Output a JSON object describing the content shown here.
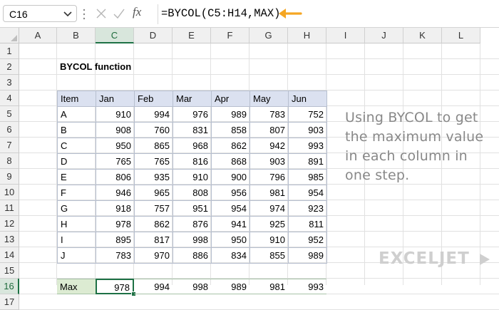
{
  "name_box": {
    "value": "C16"
  },
  "formula_bar": {
    "fx_label": "fx",
    "formula": "=BYCOL(C5:H14,MAX)"
  },
  "columns": [
    "A",
    "B",
    "C",
    "D",
    "E",
    "F",
    "G",
    "H",
    "I",
    "J",
    "K",
    "L"
  ],
  "rows": [
    "1",
    "2",
    "3",
    "4",
    "5",
    "6",
    "7",
    "8",
    "9",
    "10",
    "11",
    "12",
    "13",
    "14",
    "15",
    "16",
    "17"
  ],
  "selected": {
    "column": "C",
    "row": "16"
  },
  "sheet": {
    "title": "BYCOL function",
    "headers": [
      "Item",
      "Jan",
      "Feb",
      "Mar",
      "Apr",
      "May",
      "Jun"
    ],
    "data": [
      [
        "A",
        "910",
        "994",
        "976",
        "989",
        "783",
        "752"
      ],
      [
        "B",
        "908",
        "760",
        "831",
        "858",
        "807",
        "903"
      ],
      [
        "C",
        "950",
        "865",
        "968",
        "862",
        "942",
        "993"
      ],
      [
        "D",
        "765",
        "765",
        "816",
        "868",
        "903",
        "891"
      ],
      [
        "E",
        "806",
        "935",
        "910",
        "900",
        "796",
        "985"
      ],
      [
        "F",
        "946",
        "965",
        "808",
        "956",
        "981",
        "954"
      ],
      [
        "G",
        "918",
        "757",
        "951",
        "954",
        "974",
        "923"
      ],
      [
        "H",
        "978",
        "862",
        "876",
        "941",
        "925",
        "811"
      ],
      [
        "I",
        "895",
        "817",
        "998",
        "950",
        "910",
        "952"
      ],
      [
        "J",
        "783",
        "970",
        "886",
        "834",
        "855",
        "989"
      ]
    ],
    "max_label": "Max",
    "max_values": [
      "978",
      "994",
      "998",
      "989",
      "981",
      "993"
    ]
  },
  "note": "Using BYCOL to get the maximum value in each column in one step.",
  "logo": {
    "text": "EXCELJET"
  },
  "colors": {
    "accent_green": "#1e7145",
    "arrow_orange": "#f5a623",
    "table_header_bg": "#dbe1f0",
    "max_label_bg": "#dcebd2"
  },
  "icons": {
    "name_dropdown": "chevron-down-icon",
    "cancel": "x-icon",
    "enter": "check-icon",
    "pointer": "arrow-left-icon"
  }
}
